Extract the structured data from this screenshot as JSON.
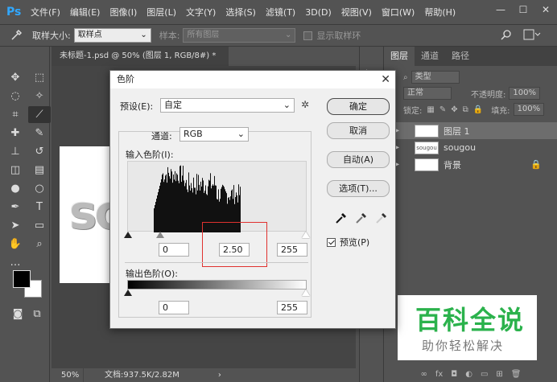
{
  "app": {
    "logo": "Ps",
    "menu": [
      "文件(F)",
      "编辑(E)",
      "图像(I)",
      "图层(L)",
      "文字(Y)",
      "选择(S)",
      "滤镜(T)",
      "3D(D)",
      "视图(V)",
      "窗口(W)",
      "帮助(H)"
    ],
    "window_buttons": [
      "—",
      "☐",
      "✕"
    ]
  },
  "options_bar": {
    "sample_size_label": "取样大小:",
    "sample_size_value": "取样点",
    "sample_label": "样本:",
    "sample_value": "所有图层",
    "show_ring_label": "显示取样环"
  },
  "document": {
    "tab_title": "未标题-1.psd @ 50% (图层 1, RGB/8#) *",
    "canvas_text": "so",
    "zoom": "50%",
    "doc_info": "文档:937.5K/2.82M"
  },
  "layers_panel": {
    "tabs": [
      "图层",
      "通道",
      "路径"
    ],
    "kind_label": "类型",
    "blend_mode": "正常",
    "opacity_label": "不透明度:",
    "opacity_value": "100%",
    "lock_label": "锁定:",
    "fill_label": "填充:",
    "fill_value": "100%",
    "layers": [
      {
        "name": "图层 1",
        "thumb": "",
        "active": true
      },
      {
        "name": "sougou",
        "thumb": "sougou",
        "active": false
      },
      {
        "name": "背景",
        "thumb": "",
        "active": false
      }
    ]
  },
  "watermark": {
    "title": "百科全说",
    "subtitle": "助你轻松解决"
  },
  "dialog": {
    "title": "色阶",
    "preset_label": "预设(E):",
    "preset_value": "自定",
    "channel_label": "通道:",
    "channel_value": "RGB",
    "input_label": "输入色阶(I):",
    "input_black": "0",
    "input_gamma": "2.50",
    "input_white": "255",
    "output_label": "输出色阶(O):",
    "output_black": "0",
    "output_white": "255",
    "buttons": {
      "ok": "确定",
      "cancel": "取消",
      "auto": "自动(A)",
      "options": "选项(T)..."
    },
    "preview_label": "预览(P)",
    "preview_checked": true,
    "highlight_color": "#e0312f"
  }
}
